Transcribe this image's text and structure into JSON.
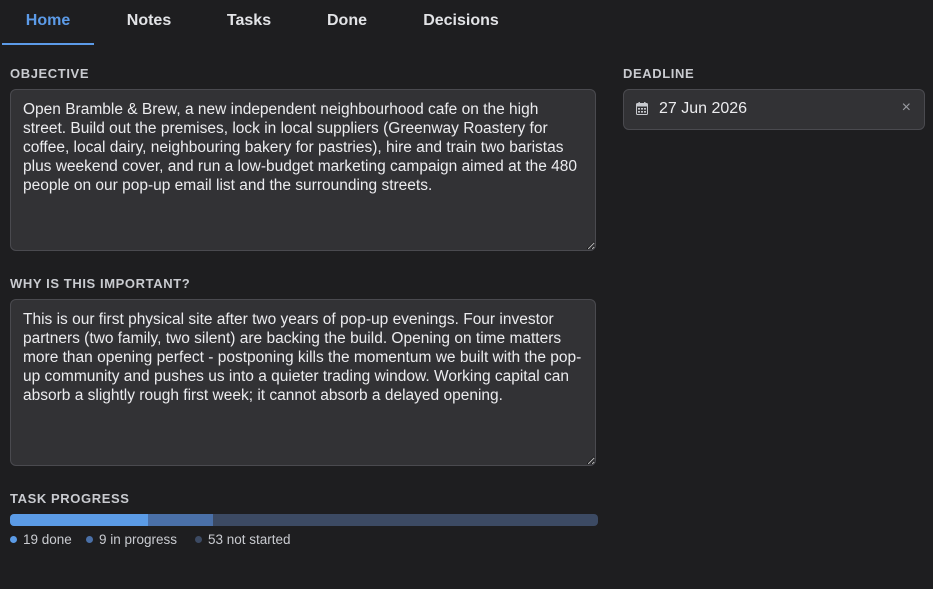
{
  "tabs": [
    {
      "label": "Home",
      "active": true
    },
    {
      "label": "Notes",
      "active": false
    },
    {
      "label": "Tasks",
      "active": false
    },
    {
      "label": "Done",
      "active": false
    },
    {
      "label": "Decisions",
      "active": false
    }
  ],
  "objective": {
    "label": "OBJECTIVE",
    "value": "Open Bramble & Brew, a new independent neighbourhood cafe on the high street. Build out the premises, lock in local suppliers (Greenway Roastery for coffee, local dairy, neighbouring bakery for pastries), hire and train two baristas plus weekend cover, and run a low-budget marketing campaign aimed at the 480 people on our pop-up email list and the surrounding streets."
  },
  "importance": {
    "label": "WHY IS THIS IMPORTANT?",
    "value": "This is our first physical site after two years of pop-up evenings. Four investor partners (two family, two silent) are backing the build. Opening on time matters more than opening perfect - postponing kills the momentum we built with the pop-up community and pushes us into a quieter trading window. Working capital can absorb a slightly rough first week; it cannot absorb a delayed opening."
  },
  "deadline": {
    "label": "DEADLINE",
    "value": "27 Jun 2026",
    "icon": "calendar-icon",
    "clear_icon": "close-icon",
    "clear_glyph": "×"
  },
  "progress": {
    "label": "TASK PROGRESS",
    "done": 19,
    "in_progress": 9,
    "not_started": 53,
    "done_text": "19 done",
    "in_progress_text": "9 in progress",
    "not_started_text": "53 not started",
    "colors": {
      "done": "#5b9be6",
      "in_progress": "#4a70a8",
      "not_started": "#3c4a63"
    }
  },
  "colors": {
    "accent": "#5c9be8",
    "background": "#1e1e20",
    "field": "#323235"
  }
}
